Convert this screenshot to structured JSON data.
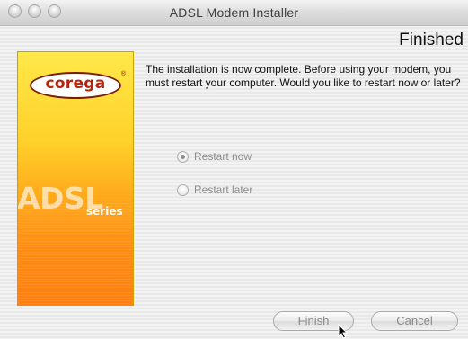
{
  "window": {
    "title": "ADSL Modem Installer"
  },
  "page": {
    "heading": "Finished"
  },
  "sidebar": {
    "logo": "corega",
    "logo_mark": "®",
    "brand_large": "ADSL",
    "brand_small": "series"
  },
  "message": "The installation is now complete.  Before using your modem, you must restart your computer.  Would you like to restart now or later?",
  "options": [
    {
      "label": "Restart now",
      "checked": true
    },
    {
      "label": "Restart later",
      "checked": false
    }
  ],
  "buttons": {
    "finish": "Finish",
    "cancel": "Cancel"
  }
}
